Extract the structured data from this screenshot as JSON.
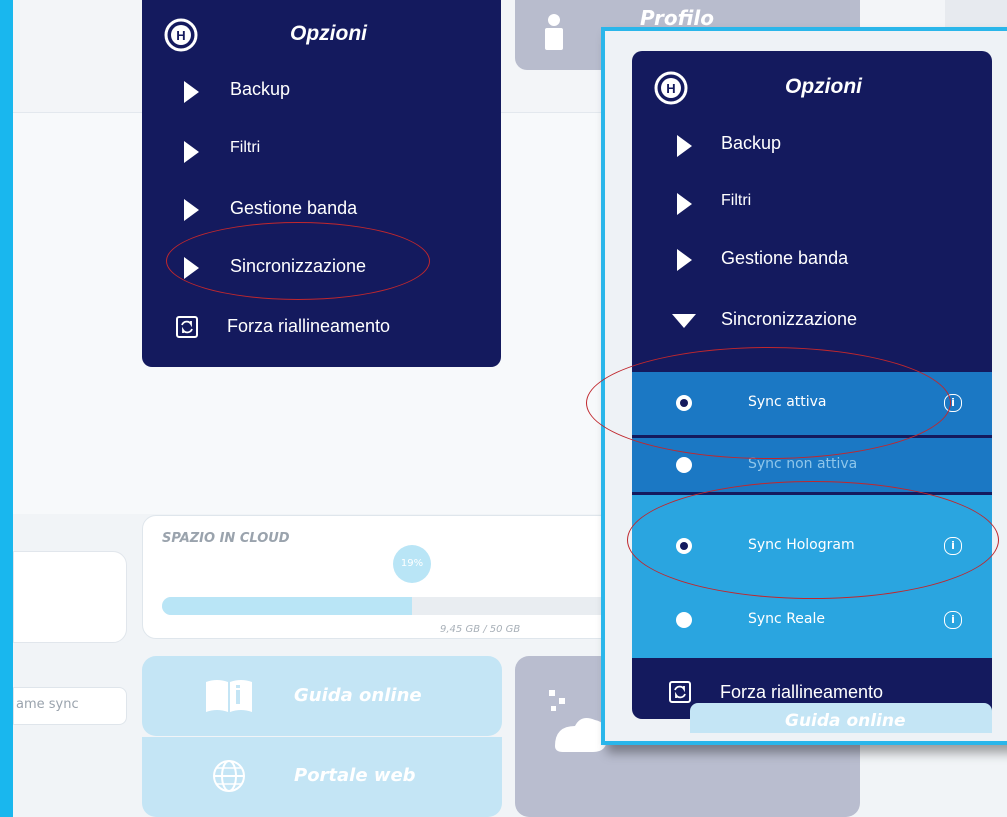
{
  "menu": {
    "title": "Opzioni",
    "items": [
      {
        "label": "Backup"
      },
      {
        "label": "Filtri"
      },
      {
        "label": "Gestione banda"
      },
      {
        "label": "Sincronizzazione"
      }
    ],
    "force_label": "Forza riallineamento"
  },
  "zoom_menu": {
    "title": "Opzioni",
    "items": [
      {
        "label": "Backup"
      },
      {
        "label": "Filtri"
      },
      {
        "label": "Gestione banda"
      },
      {
        "label": "Sincronizzazione"
      }
    ],
    "sync_options": [
      {
        "label": "Sync attiva",
        "selected": true,
        "info": "i"
      },
      {
        "label": "Sync non attiva",
        "selected": false
      },
      {
        "label": "Sync Hologram",
        "selected": true,
        "info": "i"
      },
      {
        "label": "Sync Reale",
        "selected": false,
        "info": "i"
      }
    ],
    "force_label": "Forza riallineamento",
    "guide_label": "Guida online"
  },
  "profile": {
    "title": "Profilo"
  },
  "cloud": {
    "title": "SPAZIO IN CLOUD",
    "percent_label": "19%",
    "storage_text": "9,45 GB / 50 GB",
    "usage_fraction": 0.19
  },
  "sync_name_placeholder": "ame sync",
  "buttons": {
    "guide": "Guida online",
    "web": "Portale web"
  },
  "colors": {
    "menu_bg": "#141a5e",
    "sync_selected": "#1b78c4",
    "sync_light": "#2aa5e0",
    "accent": "#19b7ee",
    "annotation": "#c0272d"
  }
}
